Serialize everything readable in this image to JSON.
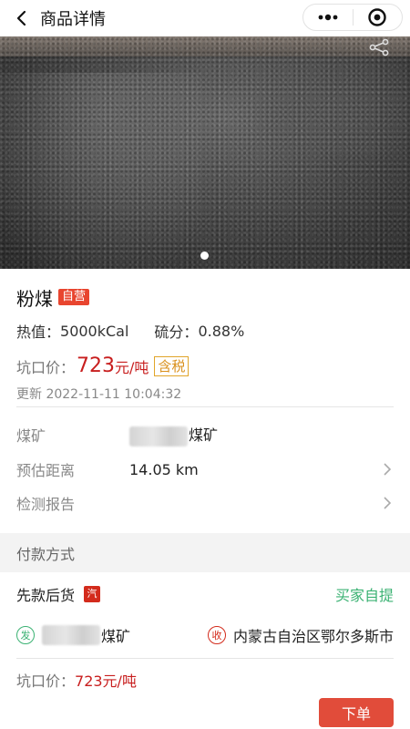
{
  "header": {
    "title": "商品详情",
    "back_icon": "chevron-left-icon",
    "more_icon": "more-dots-icon",
    "target_icon": "target-icon"
  },
  "banner": {
    "share_icon": "share-icon",
    "page_indicator_count": 1
  },
  "product": {
    "name": "粉煤",
    "self_tag": "自营",
    "calorific_label": "热值：",
    "calorific_value": "5000kCal",
    "sulfur_label": "硫分：",
    "sulfur_value": "0.88%",
    "price_label": "坑口价：",
    "price_value": "723",
    "price_unit": "元/吨",
    "tax_tag": "含税",
    "updated_label": "更新",
    "updated_time": "2022-11-11 10:04:32"
  },
  "details": {
    "mine_label": "煤矿",
    "mine_value": "煤矿",
    "distance_label": "预估距离",
    "distance_value": "14.05 km",
    "report_label": "检测报告"
  },
  "payment": {
    "section_title": "付款方式",
    "mode": "先款后货",
    "vehicle_tag": "汽",
    "pickup": "买家自提"
  },
  "route": {
    "send_tag": "发",
    "from": "煤矿",
    "recv_tag": "收",
    "to": "内蒙古自治区鄂尔多斯市"
  },
  "footer": {
    "price_label": "坑口价：",
    "price_value": "723元/吨",
    "order_button": "下单"
  },
  "colors": {
    "accent_red": "#c81e1e",
    "button_red": "#e14c3a",
    "green": "#3bb273",
    "tax_orange": "#d9901c"
  }
}
